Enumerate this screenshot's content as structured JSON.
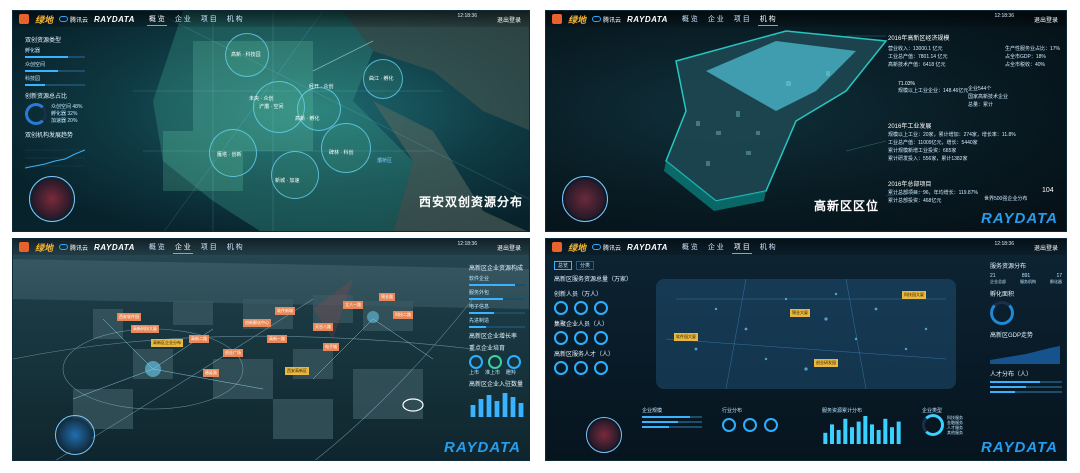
{
  "common": {
    "logo": "绿地",
    "logo_sub": "GREENLAND",
    "partner": "腾讯云",
    "brand_pre": "RAYDATA",
    "nav": [
      "概 览",
      "企 业",
      "项 目",
      "机 构"
    ],
    "exit": "退出登录",
    "watermark_pre": "RAYDATA",
    "watermark_post": ""
  },
  "panel1": {
    "title": "西安双创资源分布",
    "clock": "12:18:36",
    "side_heading": "双创资源类型",
    "side_items": [
      "孵化器",
      "众创空间",
      "科技园"
    ],
    "side_values": [
      0.72,
      0.55,
      0.34
    ],
    "stat_heading": "创新资源总占比",
    "stat_labels": [
      "众创空间",
      "孵化器",
      "加速器"
    ],
    "stat_values": [
      "48%",
      "32%",
      "20%"
    ],
    "trend_heading": "双创机构发展趋势",
    "map_labels": [
      "高新 · 科技园",
      "曲江 · 孵化",
      "经开 · 众创",
      "浐灞 · 空间",
      "高新 · 孵化",
      "雁塔 · 创新",
      "碑林 · 科创",
      "新城 · 加速",
      "未央 · 众创",
      "灞桥区"
    ]
  },
  "panel2": {
    "title": "高新区区位",
    "clock": "12:18:36",
    "sec1_head": "2016年高新区经济规模",
    "sec1_lines": [
      "营业收入：13000.1 亿元",
      "工业总产值：7801.14 亿元",
      "高新技术产值：6418 亿元"
    ],
    "sec1_right": [
      "生产性服务业占比：17%",
      "占全市GDP：18%",
      "占全市税收：40%"
    ],
    "mid_label": "企业544个",
    "mid_label2": "国家高新技术企业",
    "mid_label3": "总量：累计",
    "pct": "71.03%",
    "pct_sub": "规模以上工业企业：148.46亿元",
    "sec2_head": "2016年工业发展",
    "sec2_lines": [
      "规模以上工业：20家，累计增加：274家，增长率：11.8%",
      "工业总产值：11009亿元，增长：5440家",
      "累计规模新增工业投资：685家",
      "累计研发投入：556家，累计1382家"
    ],
    "sec3_head": "2016年总部项目",
    "sec3_lines": [
      "累计总部项目：96，年均增长：119.87%",
      "累计总部投资：468亿元"
    ],
    "badge": "世界500强企业分布",
    "count": "104"
  },
  "panel3": {
    "clock": "12:18:36",
    "orange_labels": [
      "西安软件园",
      "高新科技大厦",
      "创新孵化中心",
      "软件新城",
      "天谷八路",
      "丈八一路",
      "锦业路",
      "科技二路",
      "唐延路",
      "创业广场",
      "高新一路",
      "高新二路",
      "电子城"
    ],
    "yellow_labels": [
      "高新区企业分布",
      "西安高新区"
    ],
    "right_heading": "高新区企业资源构成",
    "right_items": [
      "软件企业",
      "服务外包",
      "电子信息",
      "先进制造"
    ],
    "right_values": [
      0.82,
      0.6,
      0.45,
      0.3
    ],
    "rate_heading": "高新区企业增长率",
    "ring_heading": "重点企业培育",
    "ring_labels": [
      "上市",
      "准上市",
      "瞪羚"
    ],
    "bars_heading": "高新区企业入驻数量",
    "bars_values": [
      6,
      9,
      11,
      8,
      12,
      10,
      7
    ]
  },
  "panel4": {
    "clock": "12:18:36",
    "tabs": [
      "总览",
      "分类"
    ],
    "left_heading": "高新区服务资源总量（万家）",
    "left_sections": [
      "创新人员（万人）",
      "集聚企业人员（人）",
      "高新区服务人才（人）"
    ],
    "ylabels": [
      "软件园大厦",
      "科技园大厦",
      "创业研发园",
      "锦业大厦"
    ],
    "right_heading": "服务资源分布",
    "right_stats": [
      "21",
      "891",
      "17"
    ],
    "right_stat_labels": [
      "企业总部",
      "服务机构",
      "孵化器"
    ],
    "donut_heading": "孵化面积",
    "area_heading": "高新区GDP走势",
    "people_heading": "人才分布（人）",
    "bottom_titles": [
      "企业规模",
      "行业分布",
      "服务资源累计分布",
      "企业类型"
    ],
    "bar_values": [
      4,
      7,
      5,
      9,
      6,
      8,
      10,
      7,
      5,
      9,
      6,
      8
    ],
    "legend_items": [
      "科技服务",
      "金融服务",
      "人才服务",
      "其他服务"
    ]
  }
}
